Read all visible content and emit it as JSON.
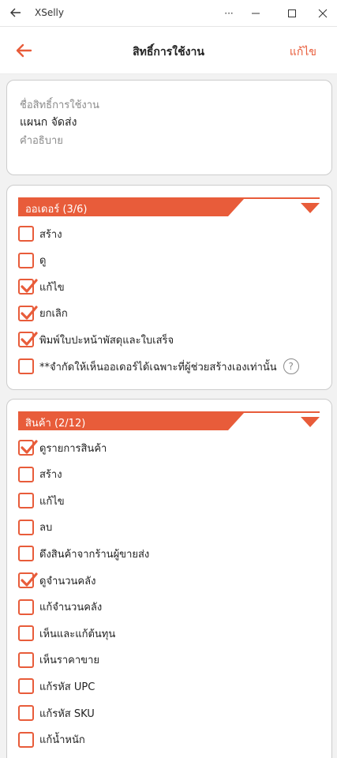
{
  "window": {
    "title": "XSelly",
    "menu_glyph": "···"
  },
  "header": {
    "title": "สิทธิ์การใช้งาน",
    "edit_label": "แก้ไข"
  },
  "info": {
    "name_label": "ชื่อสิทธิ์การใช้งาน",
    "name_value": "แผนก จัดส่ง",
    "description_label": "คำอธิบาย"
  },
  "colors": {
    "accent": "#e85c3a"
  },
  "orders": {
    "title": "ออเดอร์ (3/6)",
    "items": [
      {
        "label": "สร้าง",
        "checked": false
      },
      {
        "label": "ดู",
        "checked": false
      },
      {
        "label": "แก้ไข",
        "checked": true
      },
      {
        "label": "ยกเลิก",
        "checked": true
      },
      {
        "label": "พิมพ์ใบปะหน้าพัสดุและใบเสร็จ",
        "checked": true
      },
      {
        "label": "**จำกัดให้เห็นออเดอร์ได้เฉพาะที่ผู้ช่วยสร้างเองเท่านั้น",
        "checked": false
      }
    ],
    "help_glyph": "?"
  },
  "products": {
    "title": "สินค้า (2/12)",
    "items": [
      {
        "label": "ดูรายการสินค้า",
        "checked": true
      },
      {
        "label": "สร้าง",
        "checked": false
      },
      {
        "label": "แก้ไข",
        "checked": false
      },
      {
        "label": "ลบ",
        "checked": false
      },
      {
        "label": "ดึงสินค้าจากร้านผู้ขายส่ง",
        "checked": false
      },
      {
        "label": "ดูจำนวนคลัง",
        "checked": true
      },
      {
        "label": "แก้จำนวนคลัง",
        "checked": false
      },
      {
        "label": "เห็นและแก้ต้นทุน",
        "checked": false
      },
      {
        "label": "เห็นราคาขาย",
        "checked": false
      },
      {
        "label": "แก้รหัส UPC",
        "checked": false
      },
      {
        "label": "แก้รหัส SKU",
        "checked": false
      },
      {
        "label": "แก้น้ำหนัก",
        "checked": false
      }
    ]
  }
}
